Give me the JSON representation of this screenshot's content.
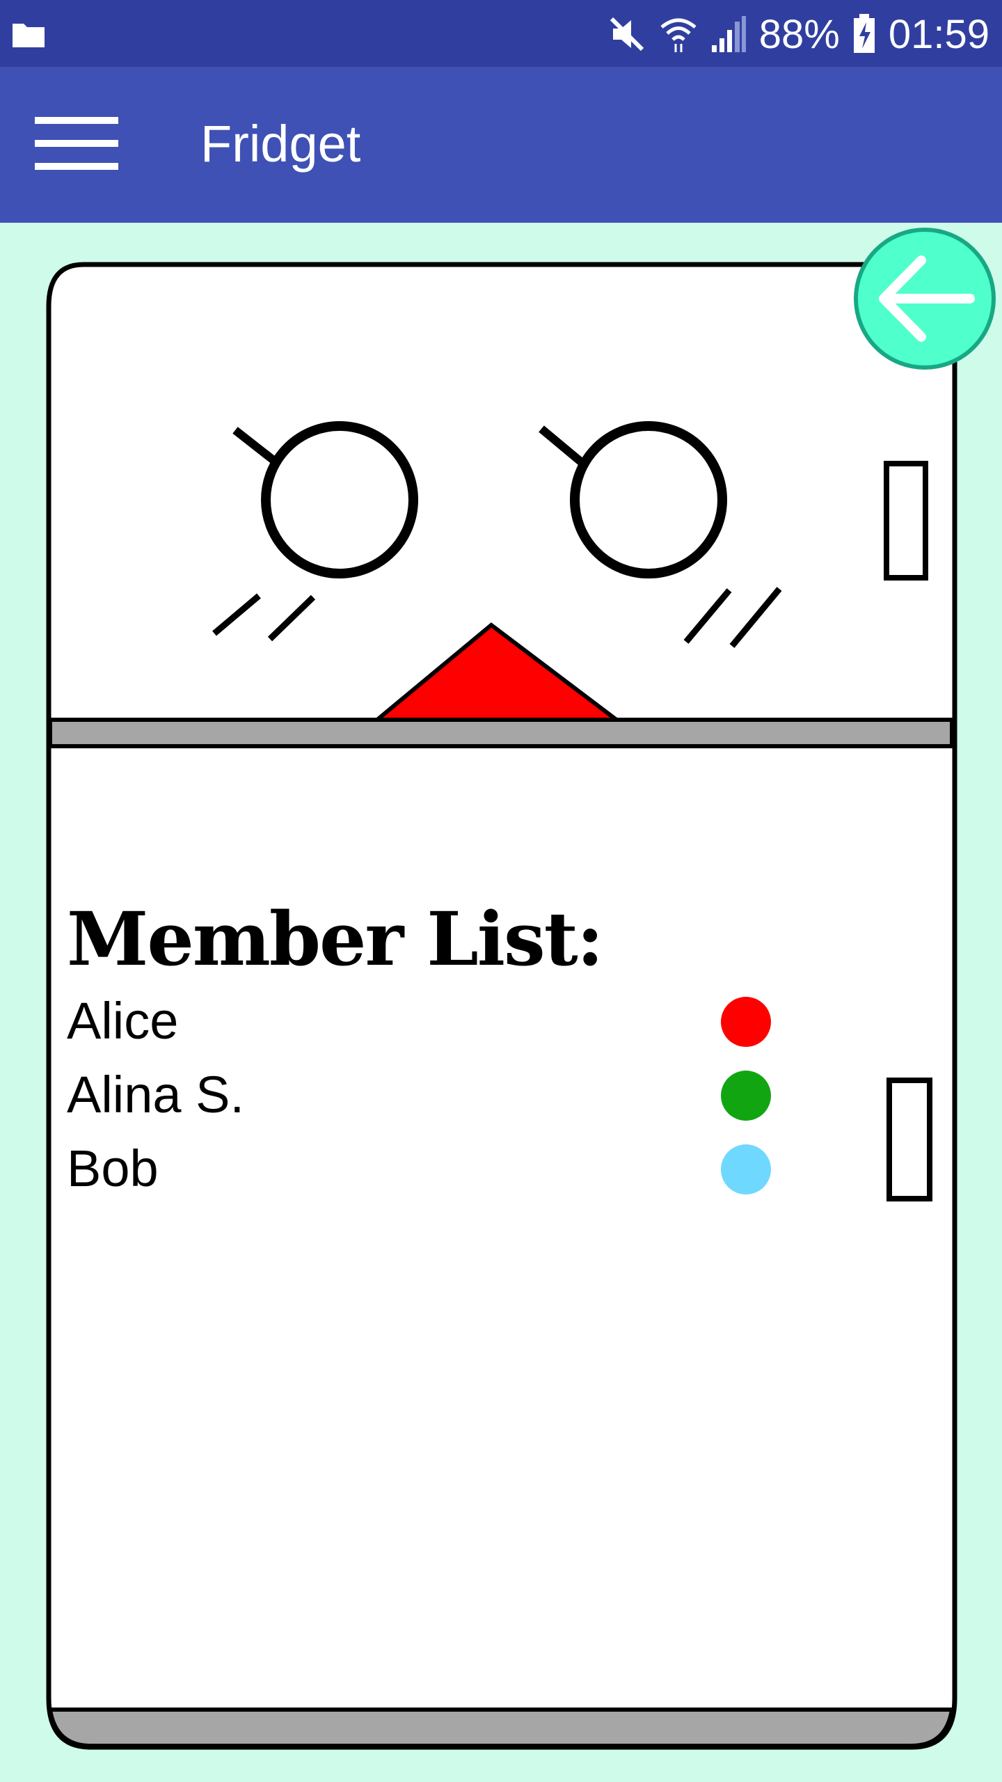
{
  "status_bar": {
    "battery_percent": "88%",
    "time": "01:59",
    "icons": [
      "folder-icon",
      "mute-icon",
      "wifi-icon",
      "signal-icon",
      "battery-charging-icon"
    ]
  },
  "app_bar": {
    "title": "Fridget",
    "menu_icon": "hamburger-menu-icon"
  },
  "members": {
    "title": "Member List:",
    "list": [
      {
        "name": "Alice",
        "color": "#ff0000"
      },
      {
        "name": "Alina S.",
        "color": "#11a611"
      },
      {
        "name": "Bob",
        "color": "#6fd8ff"
      }
    ]
  },
  "fab": {
    "icon": "back-arrow-icon",
    "color": "#4fffcc"
  },
  "colors": {
    "status_bar": "#303f9f",
    "app_bar": "#3f51b5",
    "background": "#cffbea",
    "fridge_divider": "#a6a6a6",
    "mouth": "#ff0000"
  }
}
